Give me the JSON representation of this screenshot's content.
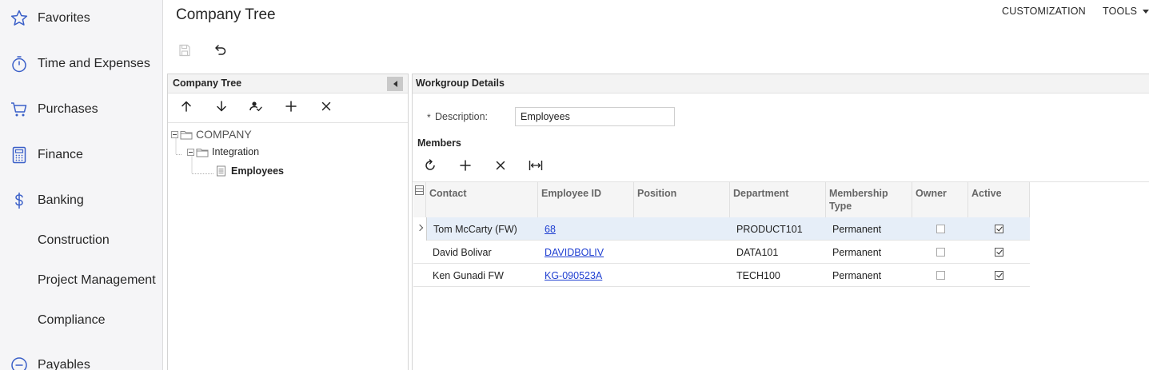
{
  "sidebar": {
    "items": [
      {
        "label": "Favorites",
        "icon": "star-icon"
      },
      {
        "label": "Time and Expenses",
        "icon": "stopwatch-icon"
      },
      {
        "label": "Purchases",
        "icon": "cart-icon"
      },
      {
        "label": "Finance",
        "icon": "calculator-icon"
      },
      {
        "label": "Banking",
        "icon": "dollar-icon"
      },
      {
        "label": "Construction",
        "icon": ""
      },
      {
        "label": "Project Management",
        "icon": ""
      },
      {
        "label": "Compliance",
        "icon": ""
      },
      {
        "label": "Payables",
        "icon": "minus-circle-icon"
      }
    ]
  },
  "header": {
    "title": "Company Tree",
    "customization": "CUSTOMIZATION",
    "tools": "TOOLS"
  },
  "tree": {
    "title": "Company Tree",
    "nodes": {
      "root": "COMPANY",
      "child": "Integration",
      "leaf": "Employees"
    }
  },
  "details": {
    "title": "Workgroup Details",
    "description_label": "Description:",
    "description_required": "*",
    "description_value": "Employees",
    "members_title": "Members"
  },
  "grid": {
    "columns": {
      "contact": "Contact",
      "employee_id": "Employee ID",
      "position": "Position",
      "department": "Department",
      "membership_type_1": "Membership",
      "membership_type_2": "Type",
      "owner": "Owner",
      "active": "Active"
    },
    "rows": [
      {
        "contact": "Tom McCarty (FW)",
        "employee_id": "68",
        "position": "",
        "department": "PRODUCT101",
        "membership_type": "Permanent",
        "owner": false,
        "active": true
      },
      {
        "contact": "David Bolivar",
        "employee_id": "DAVIDBOLIV",
        "position": "",
        "department": "DATA101",
        "membership_type": "Permanent",
        "owner": false,
        "active": true
      },
      {
        "contact": "Ken Gunadi FW",
        "employee_id": "KG-090523A",
        "position": "",
        "department": "TECH100",
        "membership_type": "Permanent",
        "owner": false,
        "active": true
      }
    ]
  },
  "colors": {
    "link": "#1f3fd1",
    "icon_blue": "#3a5fc8",
    "selected_row": "#e6eef8"
  }
}
